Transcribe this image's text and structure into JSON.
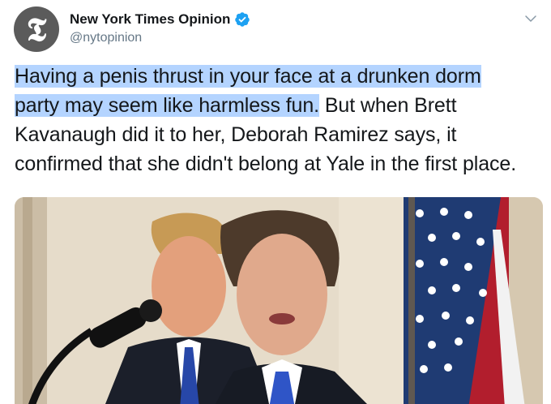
{
  "account": {
    "display_name": "New York Times Opinion",
    "handle": "@nytopinion",
    "avatar_glyph": "𝕿",
    "verified": true
  },
  "tweet": {
    "highlighted_line_1": "Having a penis thrust in your face at a drunken dorm",
    "highlighted_line_2": "party may seem like harmless fun.",
    "rest_line_2": " But when Brett",
    "line_3": "Kavanaugh did it to her, Deborah Ramirez says, it",
    "line_4": "confirmed that she didn't belong at Yale in the first place."
  },
  "icons": {
    "verified": "verified-badge-icon",
    "menu": "chevron-down-icon"
  },
  "colors": {
    "highlight": "#b4d4ff",
    "verified_blue": "#1da1f2",
    "handle_gray": "#657786"
  }
}
